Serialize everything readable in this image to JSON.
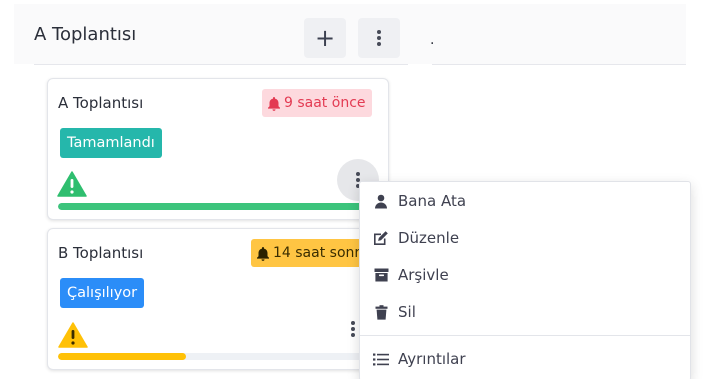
{
  "column": {
    "title": "A Toplantısı",
    "add_button_icon": "plus-icon",
    "more_button_icon": "more-vertical-icon",
    "stray_text": "."
  },
  "cards": [
    {
      "title": "A Toplantısı",
      "time_badge": "9 saat önce",
      "time_icon": "bell-icon",
      "status": "Tamamlandı",
      "warning_icon": "warning-icon",
      "progress": 1.0,
      "progress_color": "#3cc47c"
    },
    {
      "title": "B Toplantısı",
      "time_badge": "14 saat sonr",
      "time_icon": "bell-icon",
      "status": "Çalışılıyor",
      "warning_icon": "warning-icon",
      "progress": 0.4,
      "progress_color": "#ffc107"
    }
  ],
  "menu": {
    "items": [
      {
        "label": "Bana Ata",
        "icon": "user-icon"
      },
      {
        "label": "Düzenle",
        "icon": "edit-icon"
      },
      {
        "label": "Arşivle",
        "icon": "archive-icon"
      },
      {
        "label": "Sil",
        "icon": "trash-icon"
      }
    ],
    "footer_item": {
      "label": "Ayrıntılar",
      "icon": "list-icon"
    }
  },
  "colors": {
    "danger": "#e33b53",
    "danger_bg": "#fdd9de",
    "warning": "#ffc543",
    "success": "#25b7ab",
    "info": "#2b8df8",
    "progress_green": "#3cc47c",
    "progress_yellow": "#ffc107",
    "warn_icon_green": "#2fbe6f",
    "warn_icon_yellow": "#ffc107"
  }
}
